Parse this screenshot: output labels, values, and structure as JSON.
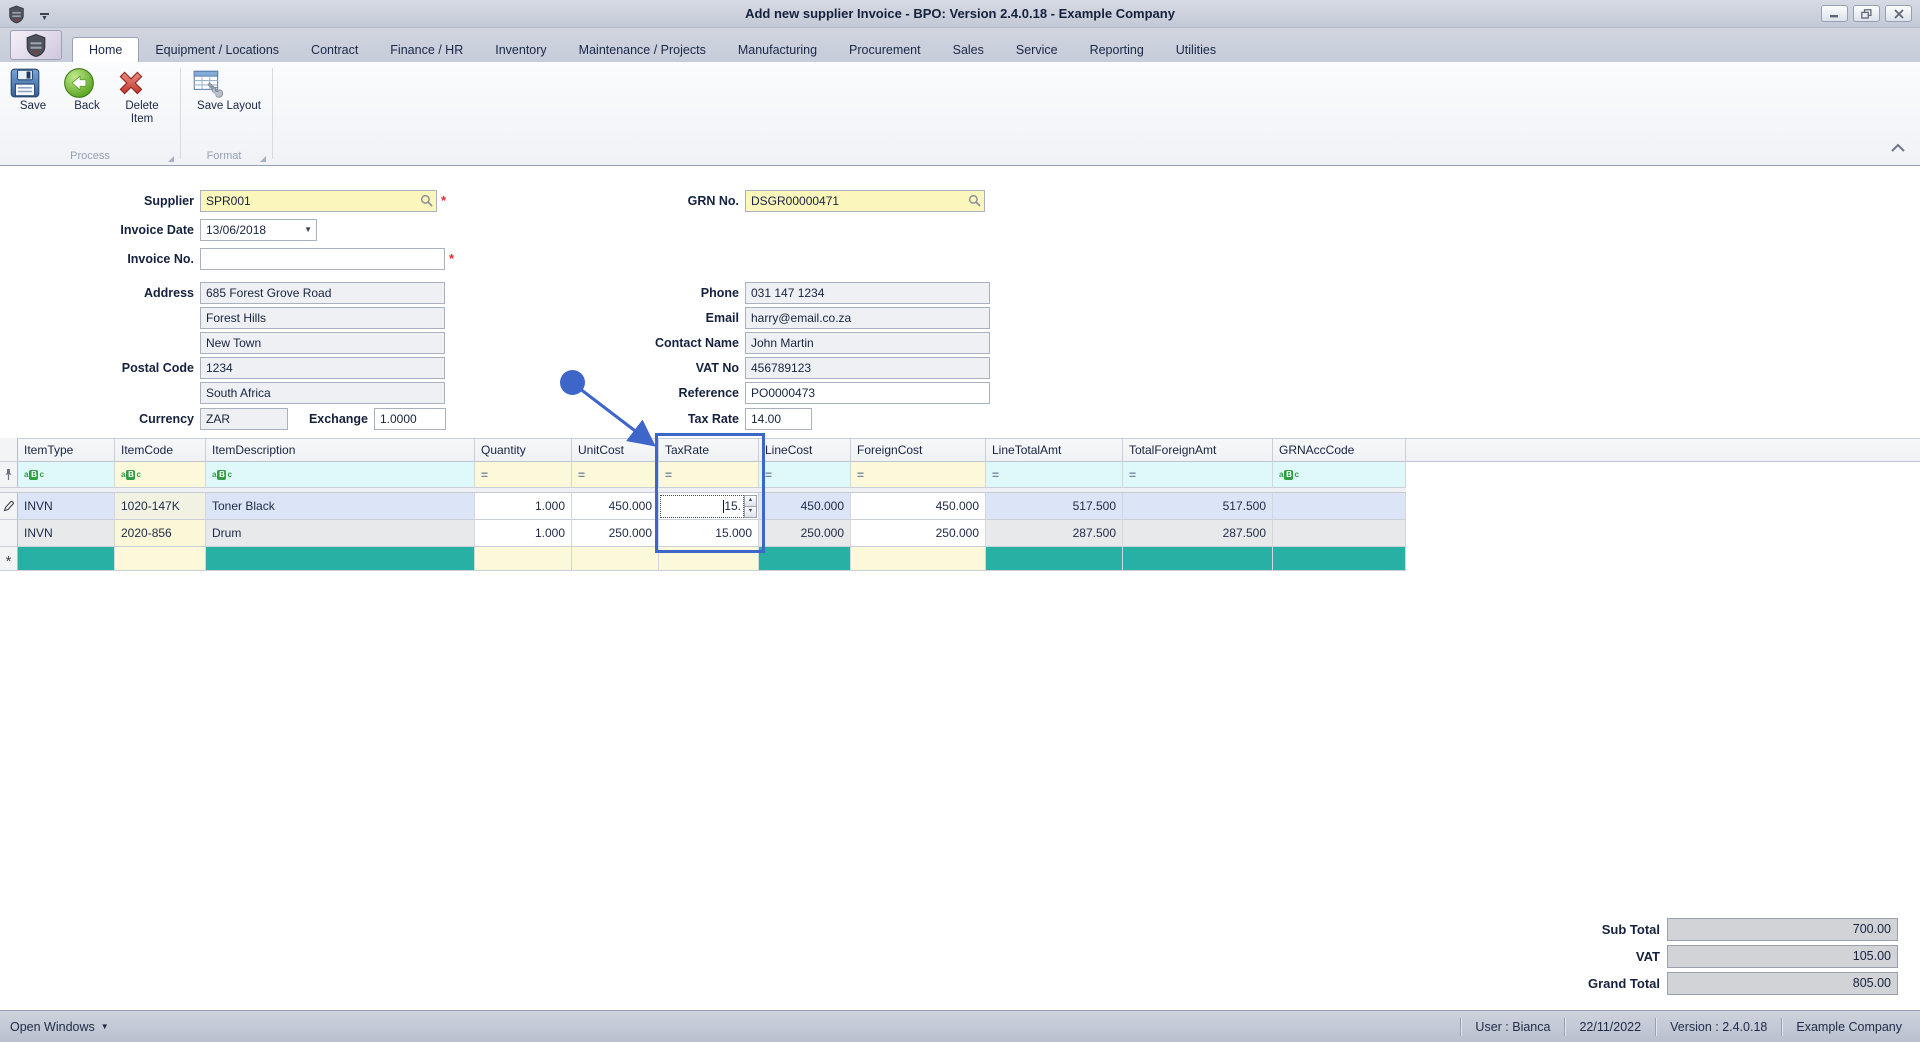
{
  "window": {
    "title_normal": "Add new supplier Invoice - ",
    "title_bold": "BPO: Version 2.4.0.18 - Example Company"
  },
  "ribbon": {
    "tabs": [
      "Home",
      "Equipment / Locations",
      "Contract",
      "Finance / HR",
      "Inventory",
      "Maintenance / Projects",
      "Manufacturing",
      "Procurement",
      "Sales",
      "Service",
      "Reporting",
      "Utilities"
    ],
    "active_tab": "Home",
    "buttons": {
      "save": "Save",
      "back": "Back",
      "delete_item": "Delete Item",
      "save_layout": "Save Layout"
    },
    "groups": {
      "process": "Process",
      "format": "Format"
    }
  },
  "form": {
    "fields": {
      "supplier": {
        "label": "Supplier",
        "value": "SPR001"
      },
      "invoice_date": {
        "label": "Invoice Date",
        "value": "13/06/2018"
      },
      "invoice_no": {
        "label": "Invoice No.",
        "value": ""
      },
      "address1": {
        "label": "Address",
        "value": "685 Forest Grove Road"
      },
      "address2": {
        "label": "",
        "value": "Forest Hills"
      },
      "address3": {
        "label": "",
        "value": "New Town"
      },
      "postal_code": {
        "label": "Postal Code",
        "value": "1234"
      },
      "country": {
        "label": "",
        "value": "South Africa"
      },
      "currency": {
        "label": "Currency",
        "value": "ZAR"
      },
      "exchange": {
        "label": "Exchange",
        "value": "1.0000"
      },
      "grn_no": {
        "label": "GRN No.",
        "value": "DSGR00000471"
      },
      "phone": {
        "label": "Phone",
        "value": "031 147 1234"
      },
      "email": {
        "label": "Email",
        "value": "harry@email.co.za"
      },
      "contact_name": {
        "label": "Contact Name",
        "value": "John Martin"
      },
      "vat_no": {
        "label": "VAT No",
        "value": "456789123"
      },
      "reference": {
        "label": "Reference",
        "value": "PO0000473"
      },
      "tax_rate": {
        "label": "Tax Rate",
        "value": "14.00"
      }
    }
  },
  "grid": {
    "columns": [
      {
        "key": "ItemType",
        "label": "ItemType",
        "filter": "abc",
        "editable": false,
        "align": "left"
      },
      {
        "key": "ItemCode",
        "label": "ItemCode",
        "filter": "abc",
        "editable": true,
        "align": "left"
      },
      {
        "key": "ItemDescription",
        "label": "ItemDescription",
        "filter": "abc",
        "editable": false,
        "align": "left"
      },
      {
        "key": "Quantity",
        "label": "Quantity",
        "filter": "eq",
        "editable": true,
        "align": "right"
      },
      {
        "key": "UnitCost",
        "label": "UnitCost",
        "filter": "eq",
        "editable": true,
        "align": "right"
      },
      {
        "key": "TaxRate",
        "label": "TaxRate",
        "filter": "eq",
        "editable": true,
        "align": "right"
      },
      {
        "key": "LineCost",
        "label": "LineCost",
        "filter": "eq",
        "editable": false,
        "align": "right"
      },
      {
        "key": "ForeignCost",
        "label": "ForeignCost",
        "filter": "eq",
        "editable": true,
        "align": "right"
      },
      {
        "key": "LineTotalAmt",
        "label": "LineTotalAmt",
        "filter": "eq",
        "editable": false,
        "align": "right"
      },
      {
        "key": "TotalForeignAmt",
        "label": "TotalForeignAmt",
        "filter": "eq",
        "editable": false,
        "align": "right"
      },
      {
        "key": "GRNAccCode",
        "label": "GRNAccCode",
        "filter": "abc",
        "editable": false,
        "align": "left"
      }
    ],
    "rows": [
      {
        "state": "editing",
        "cells": [
          "INVN",
          "1020-147K",
          "Toner Black",
          "1.000",
          "450.000",
          "15.",
          "450.000",
          "450.000",
          "517.500",
          "517.500",
          ""
        ]
      },
      {
        "state": "normal",
        "cells": [
          "INVN",
          "2020-856",
          "Drum",
          "1.000",
          "250.000",
          "15.000",
          "250.000",
          "250.000",
          "287.500",
          "287.500",
          ""
        ]
      }
    ],
    "editing": {
      "row": 0,
      "column": "TaxRate",
      "value": "15."
    },
    "highlight_column": "TaxRate"
  },
  "totals": {
    "sub_total": {
      "label": "Sub Total",
      "value": "700.00"
    },
    "vat": {
      "label": "VAT",
      "value": "105.00"
    },
    "grand_total": {
      "label": "Grand Total",
      "value": "805.00"
    }
  },
  "statusbar": {
    "open_windows": "Open Windows",
    "items": [
      "User : Bianca",
      "22/11/2022",
      "Version : 2.4.0.18",
      "Example Company"
    ]
  },
  "colors": {
    "annotation_blue": "#3e65c8",
    "new_row_teal": "#26b1a4",
    "lookup_field_yellow": "#fbf6bb",
    "selected_row_lavender": "#dce4f7"
  }
}
